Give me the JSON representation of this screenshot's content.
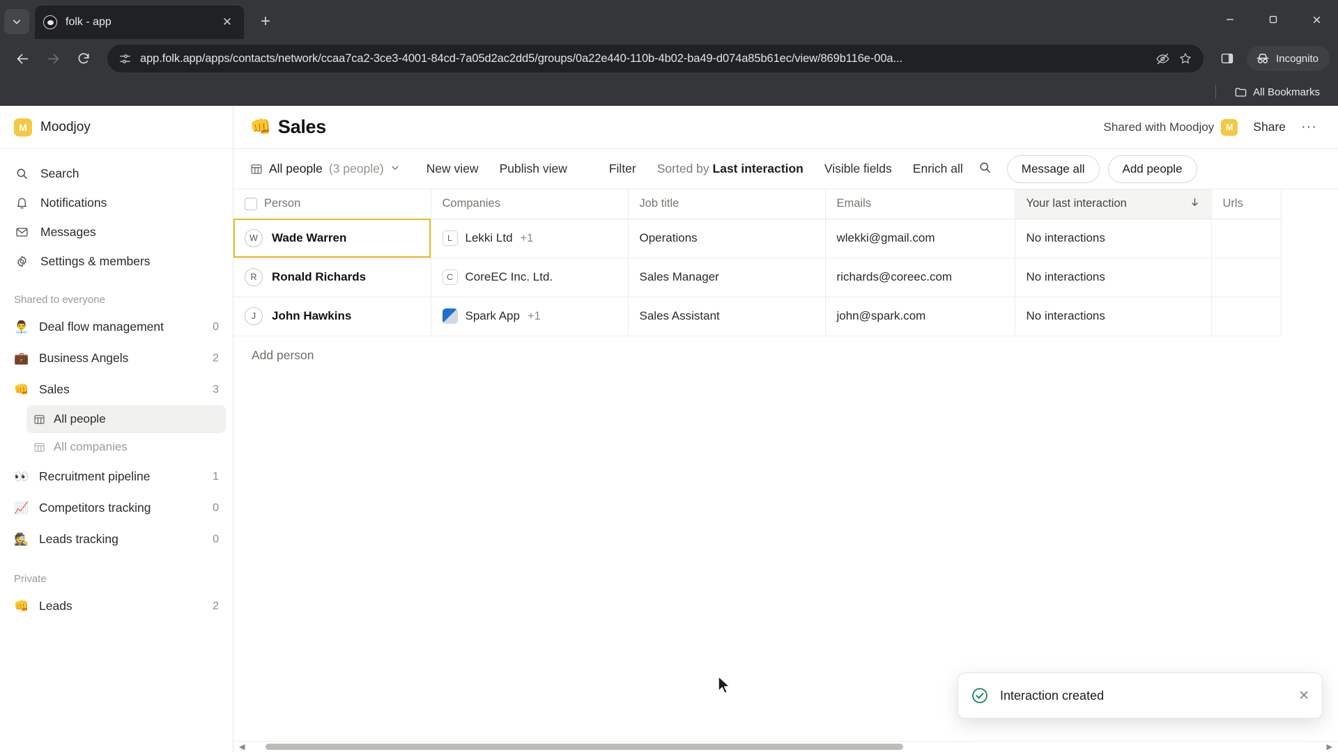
{
  "browser": {
    "tab": {
      "title": "folk - app",
      "favicon_icon": "folk-circle-icon",
      "close_icon": "close-icon"
    },
    "tab_list_icon": "chevron-down-icon",
    "new_tab_icon": "plus-icon",
    "window": {
      "minimize_icon": "minimize-icon",
      "maximize_icon": "maximize-icon",
      "close_icon": "window-close-icon"
    },
    "nav": {
      "back_icon": "arrow-left-icon",
      "forward_icon": "arrow-right-icon",
      "reload_icon": "reload-icon"
    },
    "omnibox": {
      "site_info_icon": "page-info-icon",
      "url": "app.folk.app/apps/contacts/network/ccaa7ca2-3ce3-4001-84cd-7a05d2ac2dd5/groups/0a22e440-110b-4b02-ba49-d074a85b61ec/view/869b116e-00a...",
      "tracking_icon": "eye-off-icon",
      "bookmark_icon": "star-icon"
    },
    "side_panel_icon": "side-panel-icon",
    "incognito": {
      "label": "Incognito",
      "icon": "incognito-icon"
    },
    "bookmarks": {
      "folder_icon": "folder-icon",
      "all_bookmarks_label": "All Bookmarks"
    }
  },
  "sidebar": {
    "workspace": {
      "name": "Moodjoy",
      "badge": "M",
      "badge_color": "#F5C842"
    },
    "nav": [
      {
        "label": "Search",
        "icon": "search-icon"
      },
      {
        "label": "Notifications",
        "icon": "bell-icon"
      },
      {
        "label": "Messages",
        "icon": "envelope-icon"
      },
      {
        "label": "Settings & members",
        "icon": "gear-icon"
      }
    ],
    "shared_section": {
      "label": "Shared to everyone"
    },
    "shared_groups": [
      {
        "label": "Deal flow management",
        "emoji": "👨‍💼",
        "count": "0"
      },
      {
        "label": "Business Angels",
        "emoji": "💼",
        "count": "2"
      },
      {
        "label": "Sales",
        "emoji": "👊",
        "count": "3",
        "expanded": true
      }
    ],
    "sales_views": [
      {
        "label": "All people",
        "icon": "table-icon",
        "active": true
      },
      {
        "label": "All companies",
        "icon": "table-icon",
        "active": false
      }
    ],
    "shared_groups_rest": [
      {
        "label": "Recruitment pipeline",
        "emoji": "👀",
        "count": "1"
      },
      {
        "label": "Competitors tracking",
        "emoji": "📈",
        "count": "0"
      },
      {
        "label": "Leads tracking",
        "emoji": "🕵️",
        "count": "0"
      }
    ],
    "private_section": {
      "label": "Private"
    },
    "private_groups": [
      {
        "label": "Leads",
        "emoji": "👊",
        "count": "2"
      }
    ]
  },
  "header": {
    "emoji": "👊",
    "title": "Sales",
    "shared_with_label": "Shared with Moodjoy",
    "shared_avatar": "M",
    "share_label": "Share",
    "more_icon": "ellipsis-icon",
    "more_label": "···"
  },
  "toolbar": {
    "view_icon": "table-icon",
    "view_name": "All people",
    "view_count": "(3 people)",
    "view_chevron_icon": "chevron-down-icon",
    "new_view_label": "New view",
    "publish_view_label": "Publish view",
    "filter_label": "Filter",
    "sorted_by_prefix": "Sorted by",
    "sorted_by_field": "Last interaction",
    "visible_fields_label": "Visible fields",
    "enrich_all_label": "Enrich all",
    "search_icon": "search-icon",
    "message_all_label": "Message all",
    "add_people_label": "Add people"
  },
  "table": {
    "columns": [
      {
        "label": "Person",
        "sorted": false
      },
      {
        "label": "Companies",
        "sorted": false
      },
      {
        "label": "Job title",
        "sorted": false
      },
      {
        "label": "Emails",
        "sorted": false
      },
      {
        "label": "Your last interaction",
        "sorted": true,
        "sort_icon": "arrow-down-icon"
      },
      {
        "label": "Urls",
        "sorted": false
      }
    ],
    "add_column_icon": "plus-icon",
    "rows": [
      {
        "avatar": "W",
        "person": "Wade Warren",
        "company": "Lekki Ltd",
        "company_logo": "L",
        "company_logo_type": "letter",
        "company_more": "+1",
        "job_title": "Operations",
        "email": "wlekki@gmail.com",
        "last_interaction": "No interactions",
        "urls": "",
        "focused": true
      },
      {
        "avatar": "R",
        "person": "Ronald Richards",
        "company": "CoreEC Inc. Ltd.",
        "company_logo": "C",
        "company_logo_type": "letter",
        "company_more": "",
        "job_title": "Sales Manager",
        "email": "richards@coreec.com",
        "last_interaction": "No interactions",
        "urls": "",
        "focused": false
      },
      {
        "avatar": "J",
        "person": "John Hawkins",
        "company": "Spark App",
        "company_logo": "",
        "company_logo_type": "image",
        "company_more": "+1",
        "job_title": "Sales Assistant",
        "email": "john@spark.com",
        "last_interaction": "No interactions",
        "urls": "",
        "focused": false
      }
    ],
    "add_person_label": "Add person"
  },
  "toast": {
    "message": "Interaction created",
    "icon": "check-circle-icon",
    "icon_color": "#1c8a5a",
    "close_icon": "close-icon"
  },
  "scrollbar": {
    "left_arrow": "◀",
    "right_arrow": "▶"
  }
}
